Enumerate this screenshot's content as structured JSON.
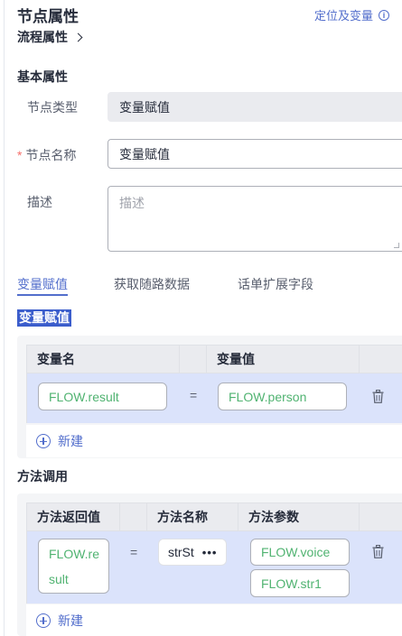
{
  "header": {
    "title": "节点属性",
    "locate_link": "定位及变量",
    "flow_link": "流程属性"
  },
  "basic": {
    "section_title": "基本属性",
    "node_type_label": "节点类型",
    "node_type_value": "变量赋值",
    "node_name_required": "*",
    "node_name_label": "节点名称",
    "node_name_value": "变量赋值",
    "desc_label": "描述",
    "desc_placeholder": "描述"
  },
  "tabs": {
    "items": [
      "变量赋值",
      "获取随路数据",
      "话单扩展字段"
    ],
    "active_index": 0
  },
  "assign": {
    "section_label": "变量赋值",
    "headers": [
      "变量名",
      "变量值"
    ],
    "rows": [
      {
        "name": "FLOW.result",
        "op": "=",
        "value": "FLOW.person"
      }
    ],
    "add_label": "新建"
  },
  "method": {
    "section_title": "方法调用",
    "headers": [
      "方法返回值",
      "方法名称",
      "方法参数"
    ],
    "rows": [
      {
        "return_line1": "FLOW.re",
        "return_line2": "sult",
        "op": "=",
        "method_name": "strSt",
        "more": "•••",
        "params": [
          "FLOW.voice",
          "FLOW.str1"
        ]
      }
    ],
    "add_label": "新建"
  },
  "colors": {
    "accent": "#526ecc",
    "selected_row": "#dbe3fb",
    "variable_text": "#50b371",
    "required": "#f66f6a"
  }
}
